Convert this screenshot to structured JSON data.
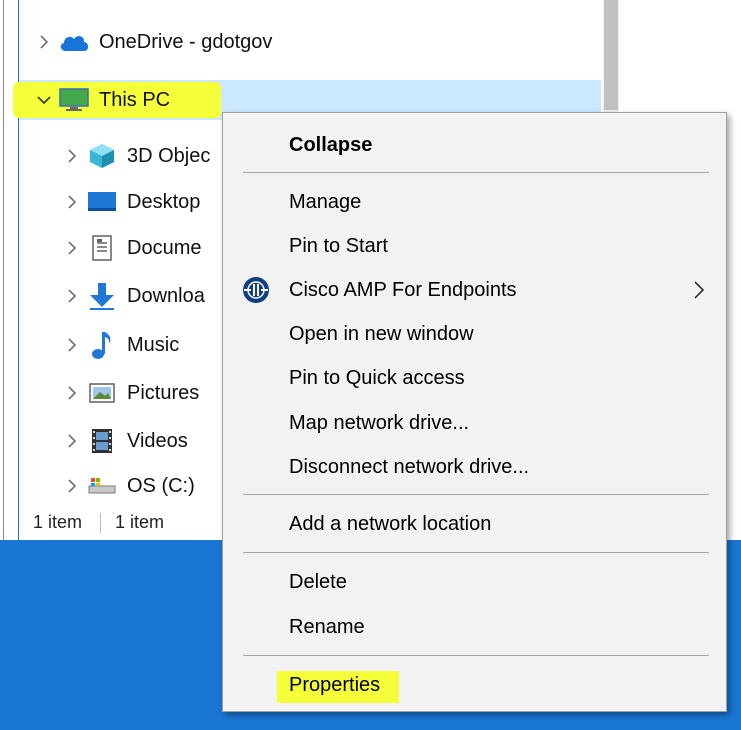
{
  "tree": {
    "onedrive": {
      "label": "OneDrive - gdotgov",
      "icon": "onedrive-cloud-icon"
    },
    "this_pc": {
      "label": "This PC",
      "icon": "monitor-icon"
    },
    "children": [
      {
        "label": "3D Objec",
        "icon": "3d-objects-icon"
      },
      {
        "label": "Desktop",
        "icon": "desktop-icon"
      },
      {
        "label": "Docume",
        "icon": "documents-icon"
      },
      {
        "label": "Downloa",
        "icon": "downloads-icon"
      },
      {
        "label": "Music",
        "icon": "music-icon"
      },
      {
        "label": "Pictures",
        "icon": "pictures-icon"
      },
      {
        "label": "Videos",
        "icon": "videos-icon"
      },
      {
        "label": "OS (C:)",
        "icon": "drive-icon"
      }
    ]
  },
  "status": {
    "left": "1 item",
    "right": "1 item"
  },
  "context_menu": {
    "collapse": "Collapse",
    "manage": "Manage",
    "pin_to_start": "Pin to Start",
    "cisco": "Cisco AMP For Endpoints",
    "open_new_window": "Open in new window",
    "pin_quick_access": "Pin to Quick access",
    "map_drive": "Map network drive...",
    "disconnect_drive": "Disconnect network drive...",
    "add_network_location": "Add a network location",
    "delete": "Delete",
    "rename": "Rename",
    "properties": "Properties"
  },
  "colors": {
    "selection": "#cce8ff",
    "highlighter": "#f4ff3a",
    "desktop": "#1976d2",
    "menu_bg": "#f2f2f2"
  }
}
